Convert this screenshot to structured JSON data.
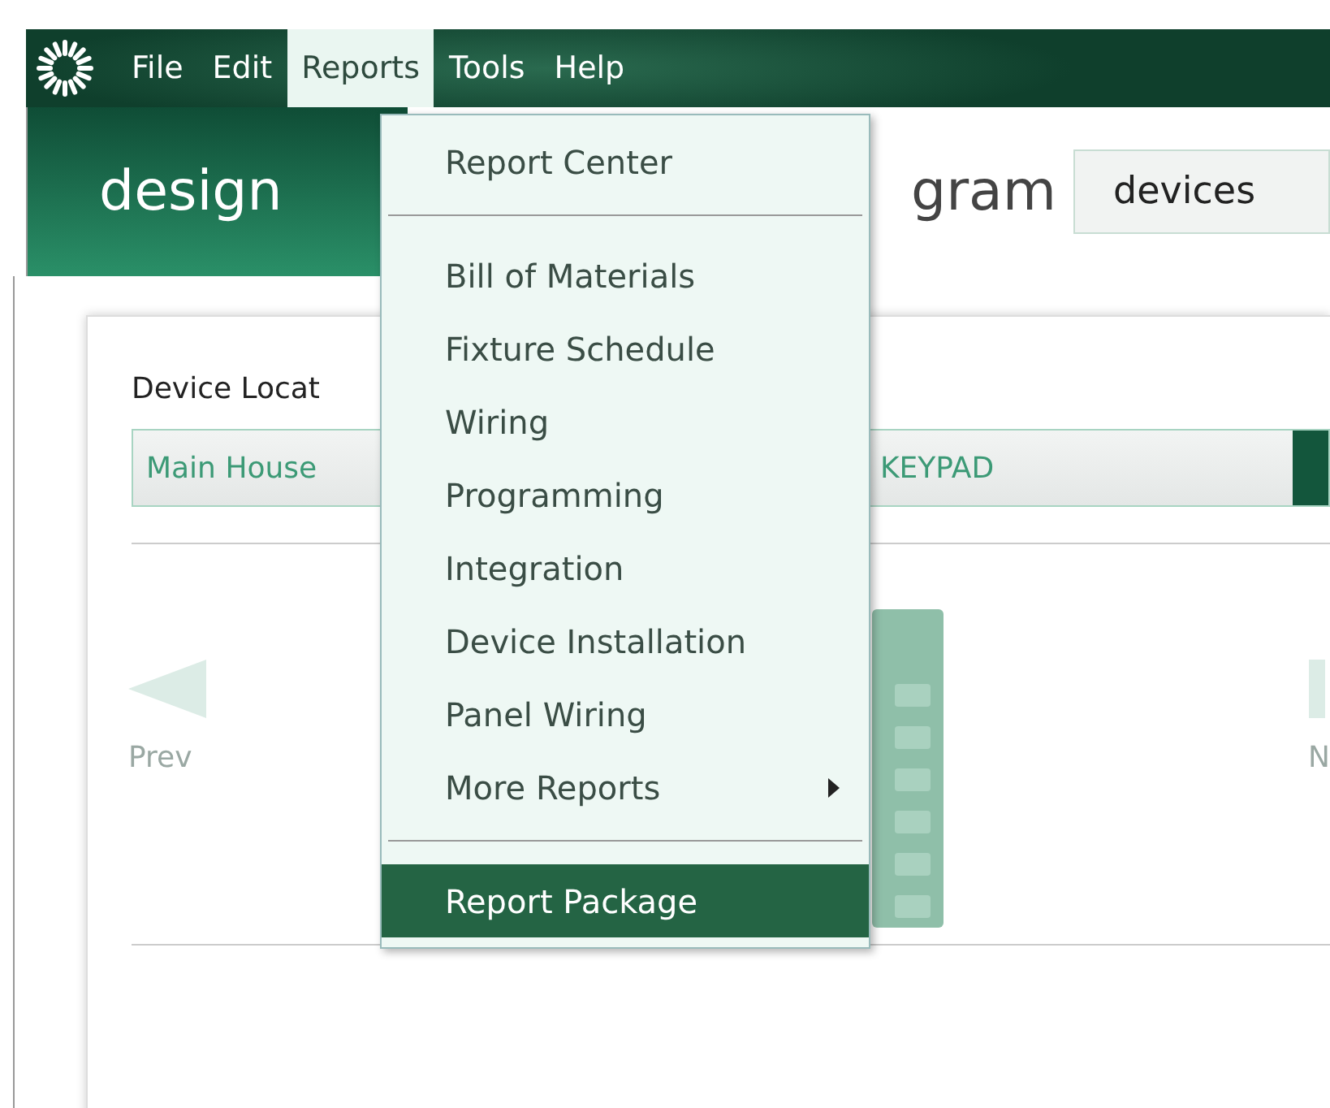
{
  "menu_bar": {
    "items": [
      {
        "label": "File",
        "selected": false
      },
      {
        "label": "Edit",
        "selected": false
      },
      {
        "label": "Reports",
        "selected": true
      },
      {
        "label": "Tools",
        "selected": false
      },
      {
        "label": "Help",
        "selected": false
      }
    ]
  },
  "header": {
    "tabs": [
      {
        "label": "design",
        "selected": true
      },
      {
        "label": "gram",
        "selected": false
      }
    ],
    "devices_field": {
      "value": "devices"
    }
  },
  "panel": {
    "location_label": "Device Locat",
    "location_dropdown": {
      "value_start": "Main House",
      "value_end": "KEYPAD"
    },
    "prev_label": "Prev",
    "next_label": "N"
  },
  "reports_menu": {
    "items": [
      {
        "kind": "item",
        "label": "Report Center",
        "has_submenu": false,
        "selected": false
      },
      {
        "kind": "separator"
      },
      {
        "kind": "item",
        "label": "Bill of Materials",
        "has_submenu": false,
        "selected": false
      },
      {
        "kind": "item",
        "label": "Fixture Schedule",
        "has_submenu": false,
        "selected": false
      },
      {
        "kind": "item",
        "label": "Wiring",
        "has_submenu": false,
        "selected": false
      },
      {
        "kind": "item",
        "label": "Programming",
        "has_submenu": false,
        "selected": false
      },
      {
        "kind": "item",
        "label": "Integration",
        "has_submenu": false,
        "selected": false
      },
      {
        "kind": "item",
        "label": "Device Installation",
        "has_submenu": false,
        "selected": false
      },
      {
        "kind": "item",
        "label": "Panel Wiring",
        "has_submenu": false,
        "selected": false
      },
      {
        "kind": "item",
        "label": "More Reports",
        "has_submenu": true,
        "selected": false
      },
      {
        "kind": "separator"
      },
      {
        "kind": "item",
        "label": "Report Package",
        "has_submenu": false,
        "selected": true
      }
    ]
  }
}
